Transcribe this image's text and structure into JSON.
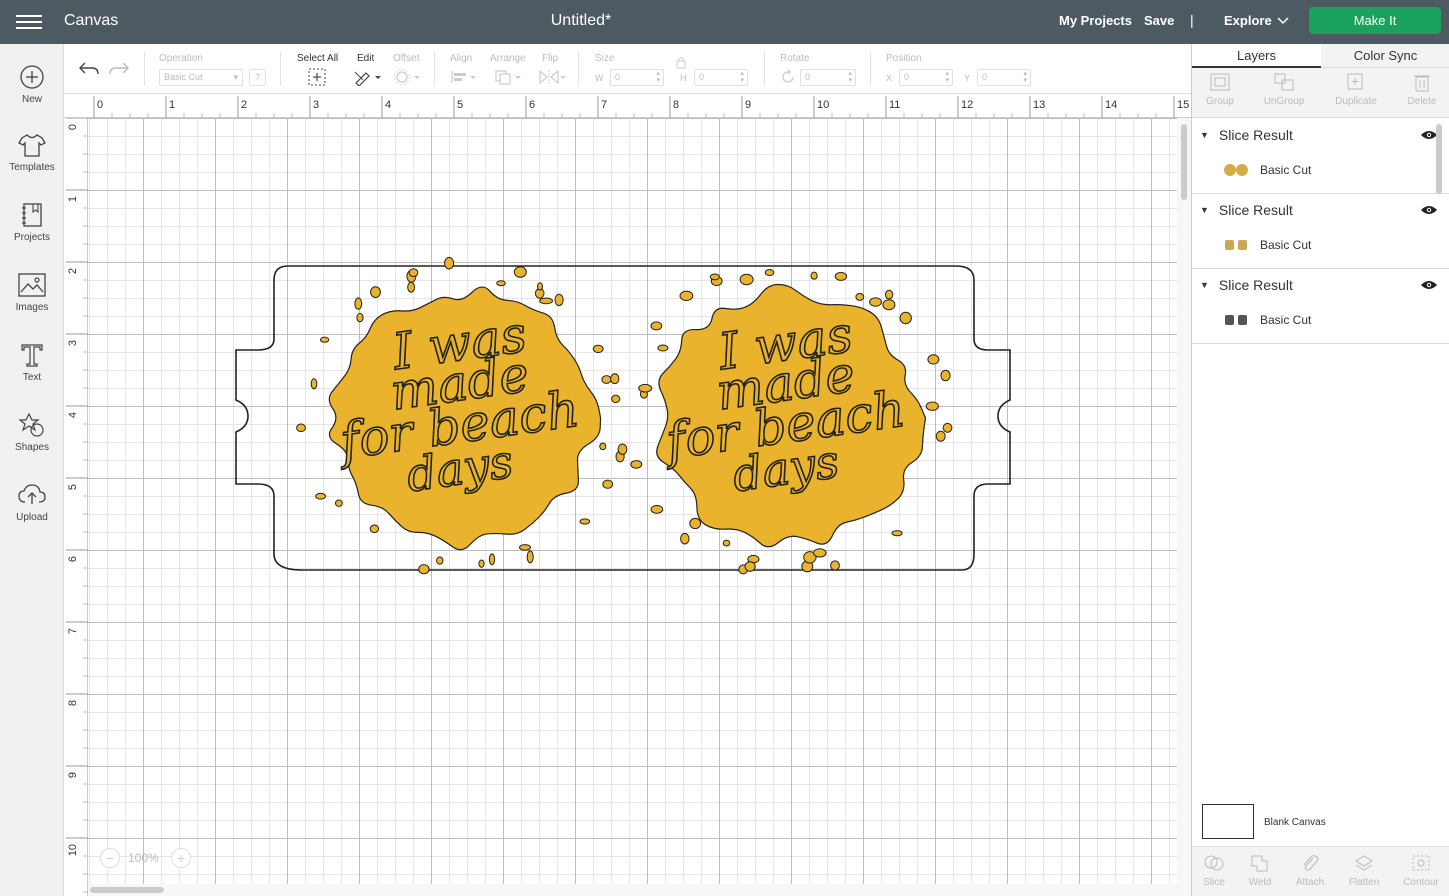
{
  "topbar": {
    "app_name": "Canvas",
    "doc_title": "Untitled*",
    "my_projects": "My Projects",
    "save": "Save",
    "separator": "|",
    "explore": "Explore",
    "make_it": "Make It",
    "make_it_color": "#1aa15d"
  },
  "sidebar": {
    "items": [
      {
        "label": "New",
        "icon": "plus-circle-icon"
      },
      {
        "label": "Templates",
        "icon": "tshirt-icon"
      },
      {
        "label": "Projects",
        "icon": "notebook-icon"
      },
      {
        "label": "Images",
        "icon": "image-icon"
      },
      {
        "label": "Text",
        "icon": "text-t-icon"
      },
      {
        "label": "Shapes",
        "icon": "shapes-icon"
      },
      {
        "label": "Upload",
        "icon": "cloud-upload-icon"
      }
    ]
  },
  "toolbar": {
    "operation_label": "Operation",
    "operation_value": "Basic Cut",
    "help": "?",
    "select_all": "Select All",
    "edit": "Edit",
    "offset": "Offset",
    "align": "Align",
    "arrange": "Arrange",
    "flip": "Flip",
    "size": "Size",
    "w_label": "W",
    "w_value": "0",
    "h_label": "H",
    "h_value": "0",
    "rotate": "Rotate",
    "rotate_value": "0",
    "position": "Position",
    "x_label": "X",
    "x_value": "0",
    "y_label": "Y",
    "y_value": "0"
  },
  "ruler": {
    "top": [
      "0",
      "1",
      "2",
      "3",
      "4",
      "5",
      "6",
      "7",
      "8",
      "9",
      "10",
      "11",
      "12",
      "13",
      "14",
      "15"
    ],
    "left": [
      "0",
      "1",
      "2",
      "3",
      "4",
      "5",
      "6",
      "7",
      "8",
      "9",
      "10"
    ]
  },
  "design": {
    "text_lines": [
      "I was",
      "made",
      "for beach",
      "days"
    ],
    "fill_color": "#e9b32e",
    "outline_color": "#222222"
  },
  "zoom": {
    "minus": "−",
    "value": "100%",
    "plus": "+"
  },
  "panel": {
    "tabs": [
      "Layers",
      "Color Sync"
    ],
    "tools": [
      "Group",
      "UnGroup",
      "Duplicate",
      "Delete"
    ],
    "layers": [
      {
        "title": "Slice Result",
        "child": "Basic Cut",
        "thumb_color": "#d4ac4a"
      },
      {
        "title": "Slice Result",
        "child": "Basic Cut",
        "thumb_color": "#c9a85a"
      },
      {
        "title": "Slice Result",
        "child": "Basic Cut",
        "thumb_color": "#555555"
      }
    ],
    "blank_canvas": "Blank Canvas",
    "bottom_tools": [
      "Slice",
      "Weld",
      "Attach",
      "Flatten",
      "Contour"
    ]
  }
}
